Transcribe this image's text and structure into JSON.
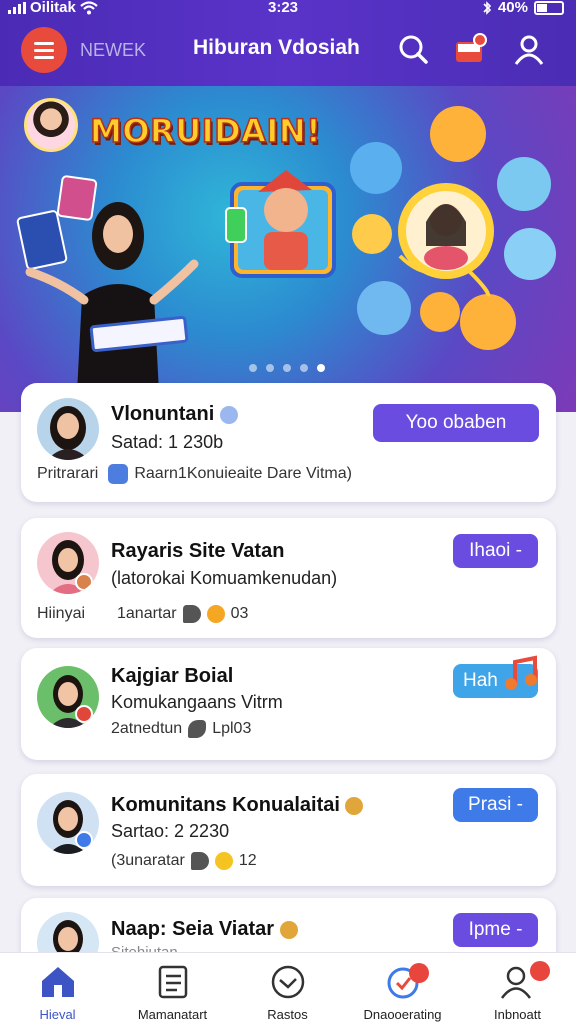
{
  "status_bar": {
    "carrier": "Oilitak",
    "time": "3:23",
    "battery": "40%"
  },
  "header": {
    "brand": "NEWEK",
    "title": "Hiburan Vdosiah"
  },
  "banner": {
    "title": "MORUIDAIN!",
    "dots": 5,
    "active_dot": 4
  },
  "cards": [
    {
      "name": "Vlonuntani",
      "sub": "Satad: 1 230b",
      "meta_left": "Pritrarari",
      "meta_text": "Raarn1Konuieaite Dare Vitma)",
      "button": "Yoo obaben"
    },
    {
      "name": "Rayaris Site Vatan",
      "sub": "(latorokai Komuamkenudan)",
      "meta_left": "Hiinyai",
      "meta_text": "1anartar",
      "meta_count": "03",
      "button": "Ihaoi -"
    },
    {
      "name": "Kajgiar Boial",
      "sub": "Komukangaans Vitrm",
      "meta_text": "2atnedtun",
      "meta_count": "Lpl03",
      "button": "Hah"
    },
    {
      "name": "Komunitans Konualaitai",
      "sub": "Sartao: 2 2230",
      "meta_text": "(3unaratar",
      "meta_count": "12",
      "button": "Prasi -"
    },
    {
      "name": "Naap: Seia Viatar",
      "sub": "Sitehiutan",
      "button": "Ipme -"
    }
  ],
  "bottom_nav": [
    {
      "label": "Hieval",
      "icon": "home-icon",
      "active": true
    },
    {
      "label": "Mamanatart",
      "icon": "list-icon"
    },
    {
      "label": "Rastos",
      "icon": "check-circle-icon"
    },
    {
      "label": "Dnaooerating",
      "icon": "chat-icon",
      "badge": ""
    },
    {
      "label": "Inbnoatt",
      "icon": "profile-icon",
      "badge": ""
    }
  ],
  "colors": {
    "header": "#4b2bb5",
    "accent_purple": "#6a4de0",
    "accent_blue": "#3e7ae8",
    "badge": "#e8453c",
    "active_nav": "#3d55c4"
  }
}
